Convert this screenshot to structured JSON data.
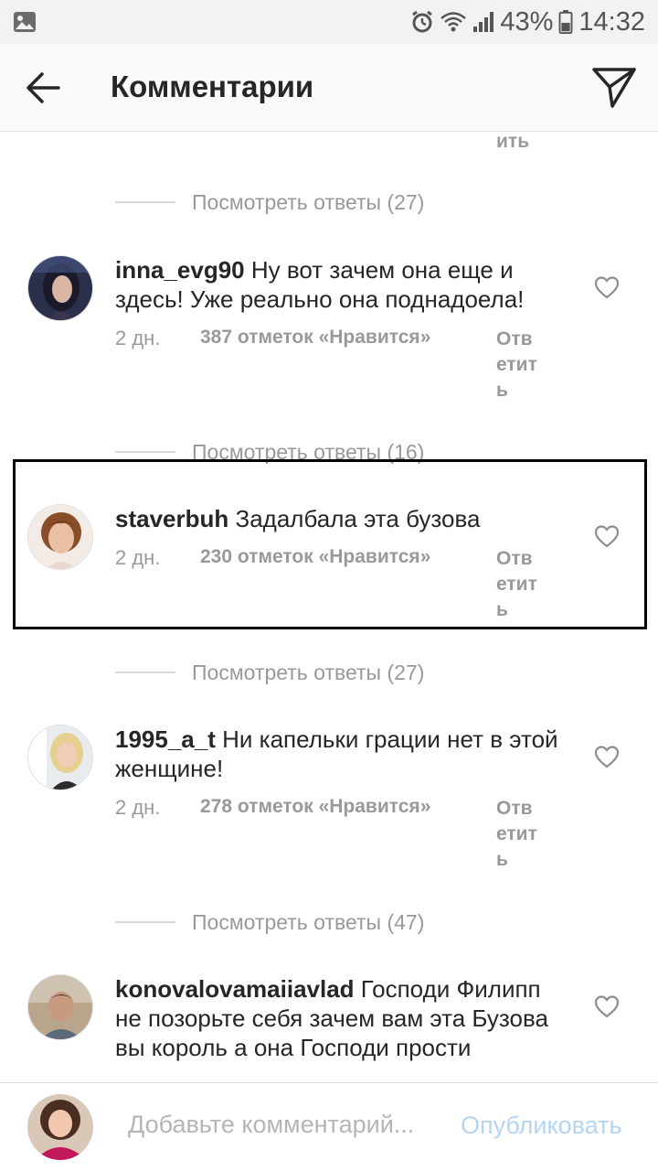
{
  "status_bar": {
    "battery": "43%",
    "time": "14:32",
    "icons": [
      "gallery-icon",
      "alarm-icon",
      "wifi-icon",
      "signal-icon",
      "battery-icon"
    ]
  },
  "header": {
    "title": "Комментарии",
    "back_icon": "arrow-left-icon",
    "send_icon": "paper-plane-icon"
  },
  "top_fragment": {
    "reply_part": "ить"
  },
  "view_replies": [
    {
      "label": "Посмотреть ответы (27)"
    },
    {
      "label": "Посмотреть ответы (16)"
    },
    {
      "label": "Посмотреть ответы (27)"
    },
    {
      "label": "Посмотреть ответы (47)"
    }
  ],
  "comments": [
    {
      "username": "inna_evg90",
      "text": "Ну вот зачем она еще и здесь! Уже реально она поднадоела!",
      "time": "2 дн.",
      "likes": "387 отметок «Нравится»",
      "reply": "Ответить"
    },
    {
      "username": "staverbuh",
      "text": "Задалбала эта бузова",
      "time": "2 дн.",
      "likes": "230 отметок «Нравится»",
      "reply": "Ответить"
    },
    {
      "username": "1995_a_t",
      "text": "Ни капельки грации нет в этой женщине!",
      "time": "2 дн.",
      "likes": "278 отметок «Нравится»",
      "reply": "Ответить"
    },
    {
      "username": "konovalovamaiiavlad",
      "text": "Господи Филипп не позорьте себя зачем вам эта Бузова вы король а она Господи прости"
    }
  ],
  "composer": {
    "placeholder": "Добавьте комментарий...",
    "publish_label": "Опубликовать"
  },
  "colors": {
    "primary_text": "#262626",
    "secondary_text": "#999999",
    "publish_disabled": "#b3d5f5",
    "highlight_border": "#000000",
    "status_bar_bg": "#f2f2f2",
    "header_bg": "#fafafa"
  }
}
